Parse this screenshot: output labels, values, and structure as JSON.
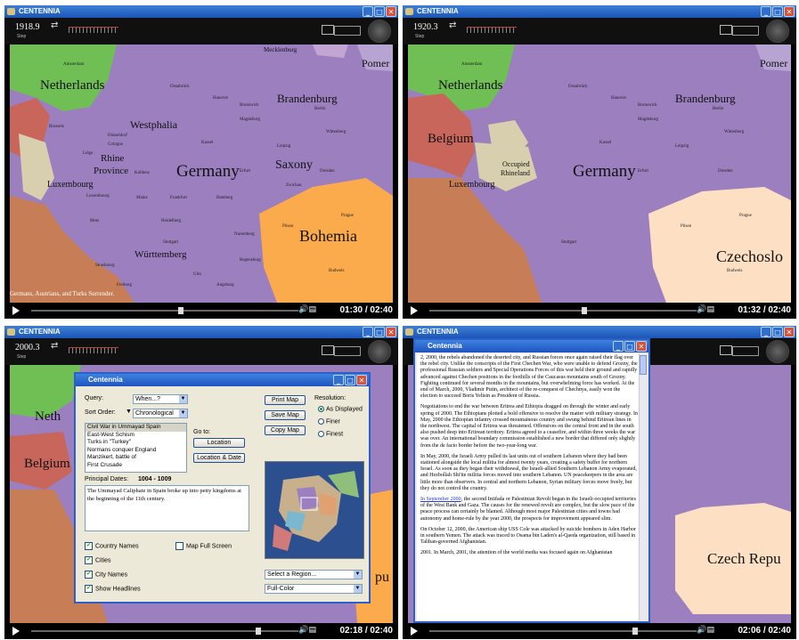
{
  "app_title": "CENTENNIA",
  "step_label": "Step",
  "panels": [
    {
      "year": "1918.9",
      "time": "01:30 / 02:40",
      "progress": 0.56,
      "caption": "Germans, Austrians, and Turks Surrender.",
      "labels": {
        "netherlands": "Netherlands",
        "pomer": "Pomer",
        "westphalia": "Westphalia",
        "brandenburg": "Brandenburg",
        "rhine": "Rhine",
        "province": "Province",
        "germany": "Germany",
        "saxony": "Saxony",
        "luxembourg": "Luxembourg",
        "bohemia": "Bohemia",
        "wurttemberg": "Württemberg",
        "mecklenburg": "Mecklenburg"
      },
      "cities": [
        "Amsterdam",
        "Osnabrück",
        "Hanover",
        "Brunswick",
        "Berlin",
        "Magdeburg",
        "Wittenberg",
        "Düsseldorf",
        "Cologne",
        "Kassel",
        "Leipzig",
        "Dresden",
        "Koblenz",
        "Erfurt",
        "Mainz",
        "Frankfurt",
        "Zwickau",
        "Bamberg",
        "Prague",
        "Pilsen",
        "Heidelberg",
        "Nuremberg",
        "Stuttgart",
        "Regensburg",
        "Budweis",
        "Ulm",
        "Augsburg",
        "Freiburg",
        "Brussels",
        "Liège",
        "Metz",
        "Strasbourg",
        "Luxembourg"
      ]
    },
    {
      "year": "1920.3",
      "time": "01:32 / 02:40",
      "progress": 0.58,
      "labels": {
        "netherlands": "Netherlands",
        "pomer": "Pomer",
        "belgium": "Belgium",
        "brandenburg": "Brandenburg",
        "occupied": "Occupied",
        "rhineland": "Rhineland",
        "germany": "Germany",
        "luxembourg": "Luxembourg",
        "czechoslo": "Czechoslo"
      }
    },
    {
      "year": "2000.3",
      "time": "02:18 / 02:40",
      "progress": 0.85,
      "labels": {
        "neth": "Neth",
        "belgium": "Belgium",
        "pu": "pu"
      },
      "dialog": {
        "title": "Centennia",
        "query_label": "Query:",
        "query_value": "When...?",
        "sort_label": "Sort Order:",
        "sort_value": "Chronological",
        "events": [
          "Civil War in Ummayad Spain",
          "East-West Schism",
          "Turks in \"Turkey\"",
          "Normans conquer England",
          "Manzikert, battle of",
          "First Crusade"
        ],
        "goto_label": "Go to:",
        "location_btn": "Location",
        "location_date_btn": "Location & Date",
        "principal_label": "Principal Dates:",
        "principal_value": "1004 - 1009",
        "description": "The Ummayad Caliphate in Spain broke up into petty kingdoms at the beginning of the 11th century.",
        "print_map": "Print Map",
        "save_map": "Save Map",
        "copy_map": "Copy Map",
        "resolution_label": "Resolution:",
        "resolutions": [
          "As Displayed",
          "Finer",
          "Finest"
        ],
        "checks": [
          {
            "label": "Country Names",
            "checked": true
          },
          {
            "label": "Cities",
            "checked": true
          },
          {
            "label": "City Names",
            "checked": true
          },
          {
            "label": "Show Headlines",
            "checked": true
          }
        ],
        "map_full_screen": "Map Full Screen",
        "region_select": "Select a Region...",
        "color_select": "Full-Color"
      }
    },
    {
      "year": "2000.3",
      "time": "02:06 / 02:40",
      "progress": 0.77,
      "labels": {
        "czech": "Czech Repu"
      },
      "textwin": {
        "title": "Centennia",
        "p1": "2, 2000, the rebels abandoned the deserted city, and Russian forces once again raised their flag over the rebel city. Unlike the conscripts of the First Chechen War, who were unable to defend Grozny, the professional Russian soldiers and Special Operations Forces of this war held their ground and rapidly advanced against Chechen positions in the foothills of the Caucasus mountains south of Grozny. Fighting continued for several months in the mountains, but overwhelming force has worked. At the end of March, 2000, Vladimir Putin, architect of the re-conquest of Chechnya, easily won the election to succeed Boris Yeltsin as President of Russia.",
        "p2": "Negotiations to end the war between Eritrea and Ethiopia dragged on through the winter and early spring of 2000. The Ethiopians plotted a bold offensive to resolve the matter with military strategy. In May, 2000 the Ethiopian infantry crossed mountainous country and swung behind Eritrean lines in the northwest. The capital of Eritrea was threatened. Offensives on the central front and in the south also pushed deep into Eritrean territory. Eritrea agreed to a ceasefire, and within three weeks the war was over. An international boundary commission established a new border that differed only slightly from the de facto border before the two-year-long war.",
        "p3": "In May, 2000, the Israeli Army pulled its last units out of southern Lebanon where they had been stationed alongside the local militia for almost twenty years, creating a safety buffer for northern Israel. As soon as they began their withdrawal, the Israeli-allied Southern Lebanon Army evaporated, and Hezbollah Shi'ite militia forces moved into southern Lebanon. UN peacekeepers in the area are little more than observers. In central and northern Lebanon, Syrian military forces move freely, but they do not control the country.",
        "p4_link": "In September 2000",
        "p4": ", the second Intifada or Palestinian Revolt began in the Israeli-occupied territories of the West Bank and Gaza. The causes for the renewed revolt are complex, but the slow pace of the peace process can certainly be blamed. Although most major Palestinian cities and towns had autonomy and home-rule by the year 2000, the prospects for improvement appeared slim.",
        "p5": "On October 12, 2000, the American ship USS Cole was attacked by suicide bombers in Aden Harbor in southern Yemen. The attack was traced to Osama bin Laden's al-Qaeda organization, still based in Taliban-governed Afghanistan.",
        "p6": "2001. In March, 2001, the attention of the world media was focused again on Afghanistan"
      }
    }
  ]
}
